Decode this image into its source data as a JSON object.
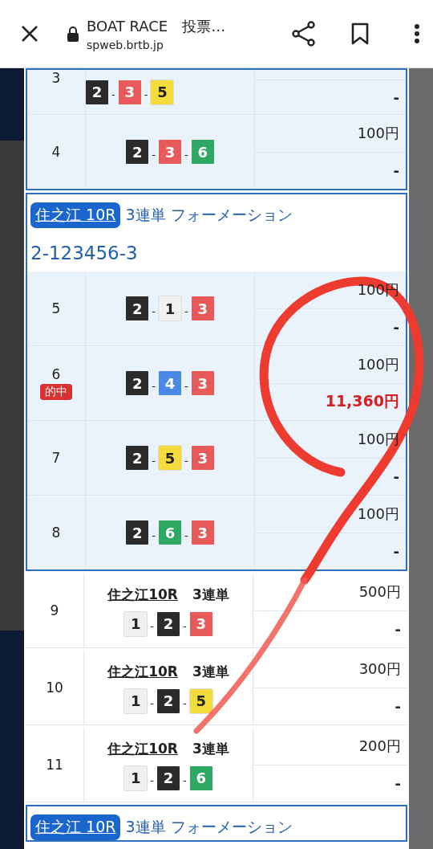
{
  "separator": "-",
  "browser": {
    "title": "BOAT RACE　投票…",
    "url": "spweb.brtb.jp"
  },
  "sections": [
    {
      "kind": "formation",
      "rows": [
        {
          "no": "3",
          "boats": [
            {
              "n": "2",
              "color": "#2b2b2b"
            },
            {
              "n": "3",
              "color": "#e85a5a"
            },
            {
              "n": "5",
              "color": "#f6db3c"
            }
          ],
          "payout": "-",
          "hit": false,
          "partial": true
        },
        {
          "no": "4",
          "boats": [
            {
              "n": "2",
              "color": "#2b2b2b"
            },
            {
              "n": "3",
              "color": "#e85a5a"
            },
            {
              "n": "6",
              "color": "#2ea862"
            }
          ],
          "amount": "100円",
          "payout": "-",
          "hit": false
        }
      ]
    },
    {
      "kind": "formation",
      "race": "住之江 10R",
      "bet_type": "3連単 フォーメーション",
      "combo": "2-123456-3",
      "rows": [
        {
          "no": "5",
          "boats": [
            {
              "n": "2",
              "color": "#2b2b2b"
            },
            {
              "n": "1",
              "color": "#f0f0f0"
            },
            {
              "n": "3",
              "color": "#e85a5a"
            }
          ],
          "amount": "100円",
          "payout": "-",
          "hit": false
        },
        {
          "no": "6",
          "badge": "的中",
          "boats": [
            {
              "n": "2",
              "color": "#2b2b2b"
            },
            {
              "n": "4",
              "color": "#4a8ae6"
            },
            {
              "n": "3",
              "color": "#e85a5a"
            }
          ],
          "amount": "100円",
          "payout": "11,360円",
          "hit": true
        },
        {
          "no": "7",
          "boats": [
            {
              "n": "2",
              "color": "#2b2b2b"
            },
            {
              "n": "5",
              "color": "#f6db3c"
            },
            {
              "n": "3",
              "color": "#e85a5a"
            }
          ],
          "amount": "100円",
          "payout": "-",
          "hit": false
        },
        {
          "no": "8",
          "boats": [
            {
              "n": "2",
              "color": "#2b2b2b"
            },
            {
              "n": "6",
              "color": "#2ea862"
            },
            {
              "n": "3",
              "color": "#e85a5a"
            }
          ],
          "amount": "100円",
          "payout": "-",
          "hit": false
        }
      ]
    },
    {
      "kind": "single",
      "no": "9",
      "race": "住之江10R",
      "bet_type": "3連単",
      "boats": [
        {
          "n": "1",
          "color": "#f0f0f0"
        },
        {
          "n": "2",
          "color": "#2b2b2b"
        },
        {
          "n": "3",
          "color": "#e85a5a"
        }
      ],
      "amount": "500円",
      "payout": "-",
      "hit": false
    },
    {
      "kind": "single",
      "no": "10",
      "race": "住之江10R",
      "bet_type": "3連単",
      "boats": [
        {
          "n": "1",
          "color": "#f0f0f0"
        },
        {
          "n": "2",
          "color": "#2b2b2b"
        },
        {
          "n": "5",
          "color": "#f6db3c"
        }
      ],
      "amount": "300円",
      "payout": "-",
      "hit": false
    },
    {
      "kind": "single",
      "no": "11",
      "race": "住之江10R",
      "bet_type": "3連単",
      "boats": [
        {
          "n": "1",
          "color": "#f0f0f0"
        },
        {
          "n": "2",
          "color": "#2b2b2b"
        },
        {
          "n": "6",
          "color": "#2ea862"
        }
      ],
      "amount": "200円",
      "payout": "-",
      "hit": false
    },
    {
      "kind": "formation",
      "race": "住之江 10R",
      "bet_type": "3連単 フォーメーション"
    }
  ]
}
